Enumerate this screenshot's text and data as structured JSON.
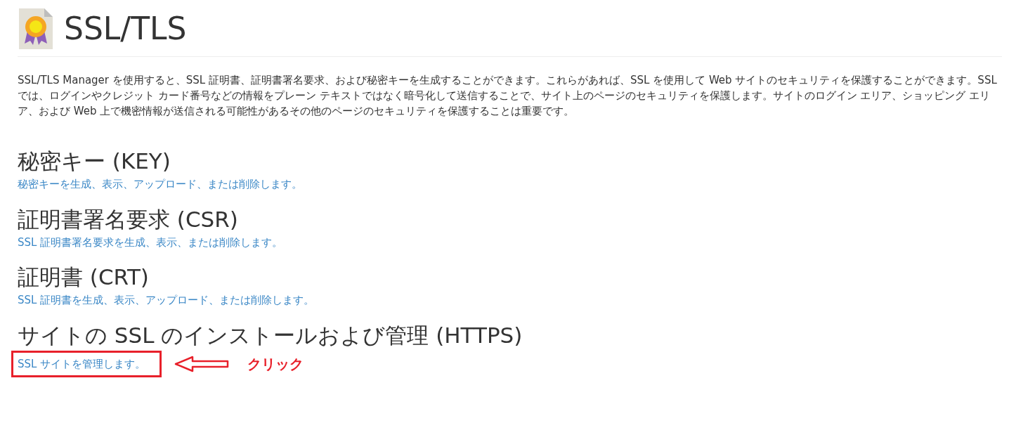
{
  "header": {
    "title": "SSL/TLS"
  },
  "description": "SSL/TLS Manager を使用すると、SSL 証明書、証明書署名要求、および秘密キーを生成することができます。これらがあれば、SSL を使用して Web サイトのセキュリティを保護することができます。SSL では、ログインやクレジット カード番号などの情報をプレーン テキストではなく暗号化して送信することで、サイト上のページのセキュリティを保護します。サイトのログイン エリア、ショッピング エリア、および Web 上で機密情報が送信される可能性があるその他のページのセキュリティを保護することは重要です。",
  "sections": [
    {
      "heading": "秘密キー (KEY)",
      "link": "秘密キーを生成、表示、アップロード、または削除します。",
      "highlighted": false
    },
    {
      "heading": "証明書署名要求 (CSR)",
      "link": "SSL 証明書署名要求を生成、表示、または削除します。",
      "highlighted": false
    },
    {
      "heading": "証明書 (CRT)",
      "link": "SSL 証明書を生成、表示、アップロード、または削除します。",
      "highlighted": false
    },
    {
      "heading": "サイトの SSL のインストールおよび管理 (HTTPS)",
      "link": "SSL サイトを管理します。",
      "highlighted": true
    }
  ],
  "annotation": {
    "label": "クリック"
  }
}
